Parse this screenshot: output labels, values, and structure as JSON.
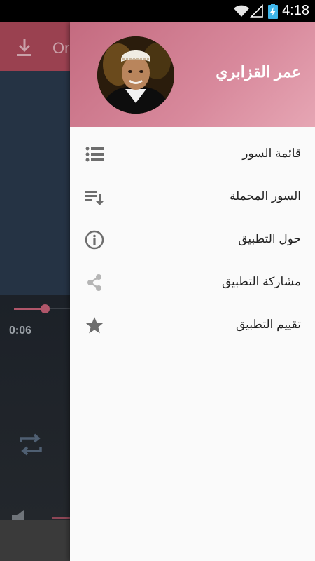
{
  "status_bar": {
    "time": "4:18",
    "icons": [
      "wifi-icon",
      "signal-icon",
      "battery-charging-icon"
    ]
  },
  "background_app": {
    "toolbar": {
      "title_partial": "Or",
      "download_icon": "download-icon",
      "color": "#9a4150"
    },
    "player": {
      "current_time": "0:06",
      "progress_fraction": 0.05,
      "repeat_icon": "repeat-icon",
      "volume_icon": "volume-icon"
    }
  },
  "drawer": {
    "header": {
      "name": "عمر القزابري",
      "avatar": "reciter-avatar"
    },
    "items": [
      {
        "label": "قائمة السور",
        "icon": "list-icon"
      },
      {
        "label": "السور المحملة",
        "icon": "download-list-icon"
      },
      {
        "label": "حول التطبيق",
        "icon": "info-icon"
      },
      {
        "label": "مشاركة التطبيق",
        "icon": "share-icon"
      },
      {
        "label": "تقييم التطبيق",
        "icon": "star-icon"
      }
    ]
  },
  "colors": {
    "accent": "#c46b80",
    "icon": "#6d6d6d",
    "icon_light": "#b5b5b5"
  }
}
